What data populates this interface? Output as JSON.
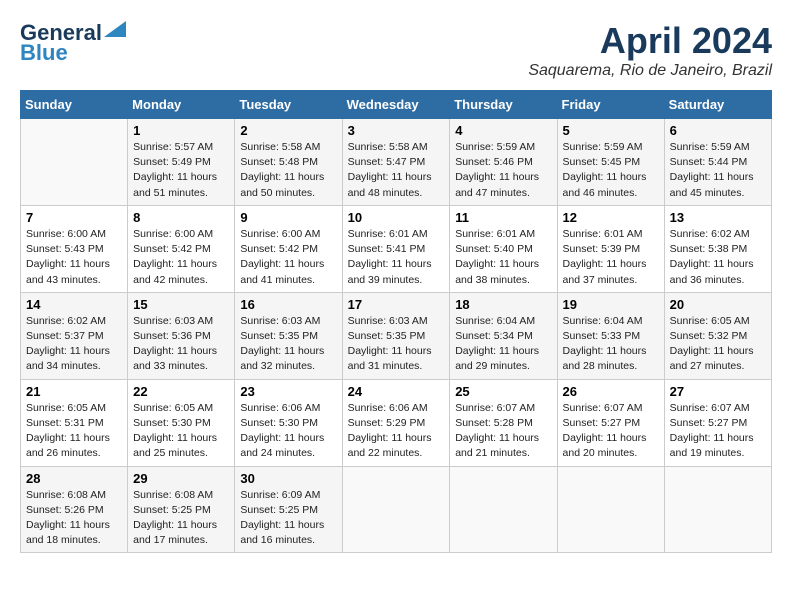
{
  "header": {
    "logo_line1": "General",
    "logo_line2": "Blue",
    "month": "April 2024",
    "location": "Saquarema, Rio de Janeiro, Brazil"
  },
  "weekdays": [
    "Sunday",
    "Monday",
    "Tuesday",
    "Wednesday",
    "Thursday",
    "Friday",
    "Saturday"
  ],
  "weeks": [
    [
      {
        "day": "",
        "info": ""
      },
      {
        "day": "1",
        "info": "Sunrise: 5:57 AM\nSunset: 5:49 PM\nDaylight: 11 hours\nand 51 minutes."
      },
      {
        "day": "2",
        "info": "Sunrise: 5:58 AM\nSunset: 5:48 PM\nDaylight: 11 hours\nand 50 minutes."
      },
      {
        "day": "3",
        "info": "Sunrise: 5:58 AM\nSunset: 5:47 PM\nDaylight: 11 hours\nand 48 minutes."
      },
      {
        "day": "4",
        "info": "Sunrise: 5:59 AM\nSunset: 5:46 PM\nDaylight: 11 hours\nand 47 minutes."
      },
      {
        "day": "5",
        "info": "Sunrise: 5:59 AM\nSunset: 5:45 PM\nDaylight: 11 hours\nand 46 minutes."
      },
      {
        "day": "6",
        "info": "Sunrise: 5:59 AM\nSunset: 5:44 PM\nDaylight: 11 hours\nand 45 minutes."
      }
    ],
    [
      {
        "day": "7",
        "info": "Sunrise: 6:00 AM\nSunset: 5:43 PM\nDaylight: 11 hours\nand 43 minutes."
      },
      {
        "day": "8",
        "info": "Sunrise: 6:00 AM\nSunset: 5:42 PM\nDaylight: 11 hours\nand 42 minutes."
      },
      {
        "day": "9",
        "info": "Sunrise: 6:00 AM\nSunset: 5:42 PM\nDaylight: 11 hours\nand 41 minutes."
      },
      {
        "day": "10",
        "info": "Sunrise: 6:01 AM\nSunset: 5:41 PM\nDaylight: 11 hours\nand 39 minutes."
      },
      {
        "day": "11",
        "info": "Sunrise: 6:01 AM\nSunset: 5:40 PM\nDaylight: 11 hours\nand 38 minutes."
      },
      {
        "day": "12",
        "info": "Sunrise: 6:01 AM\nSunset: 5:39 PM\nDaylight: 11 hours\nand 37 minutes."
      },
      {
        "day": "13",
        "info": "Sunrise: 6:02 AM\nSunset: 5:38 PM\nDaylight: 11 hours\nand 36 minutes."
      }
    ],
    [
      {
        "day": "14",
        "info": "Sunrise: 6:02 AM\nSunset: 5:37 PM\nDaylight: 11 hours\nand 34 minutes."
      },
      {
        "day": "15",
        "info": "Sunrise: 6:03 AM\nSunset: 5:36 PM\nDaylight: 11 hours\nand 33 minutes."
      },
      {
        "day": "16",
        "info": "Sunrise: 6:03 AM\nSunset: 5:35 PM\nDaylight: 11 hours\nand 32 minutes."
      },
      {
        "day": "17",
        "info": "Sunrise: 6:03 AM\nSunset: 5:35 PM\nDaylight: 11 hours\nand 31 minutes."
      },
      {
        "day": "18",
        "info": "Sunrise: 6:04 AM\nSunset: 5:34 PM\nDaylight: 11 hours\nand 29 minutes."
      },
      {
        "day": "19",
        "info": "Sunrise: 6:04 AM\nSunset: 5:33 PM\nDaylight: 11 hours\nand 28 minutes."
      },
      {
        "day": "20",
        "info": "Sunrise: 6:05 AM\nSunset: 5:32 PM\nDaylight: 11 hours\nand 27 minutes."
      }
    ],
    [
      {
        "day": "21",
        "info": "Sunrise: 6:05 AM\nSunset: 5:31 PM\nDaylight: 11 hours\nand 26 minutes."
      },
      {
        "day": "22",
        "info": "Sunrise: 6:05 AM\nSunset: 5:30 PM\nDaylight: 11 hours\nand 25 minutes."
      },
      {
        "day": "23",
        "info": "Sunrise: 6:06 AM\nSunset: 5:30 PM\nDaylight: 11 hours\nand 24 minutes."
      },
      {
        "day": "24",
        "info": "Sunrise: 6:06 AM\nSunset: 5:29 PM\nDaylight: 11 hours\nand 22 minutes."
      },
      {
        "day": "25",
        "info": "Sunrise: 6:07 AM\nSunset: 5:28 PM\nDaylight: 11 hours\nand 21 minutes."
      },
      {
        "day": "26",
        "info": "Sunrise: 6:07 AM\nSunset: 5:27 PM\nDaylight: 11 hours\nand 20 minutes."
      },
      {
        "day": "27",
        "info": "Sunrise: 6:07 AM\nSunset: 5:27 PM\nDaylight: 11 hours\nand 19 minutes."
      }
    ],
    [
      {
        "day": "28",
        "info": "Sunrise: 6:08 AM\nSunset: 5:26 PM\nDaylight: 11 hours\nand 18 minutes."
      },
      {
        "day": "29",
        "info": "Sunrise: 6:08 AM\nSunset: 5:25 PM\nDaylight: 11 hours\nand 17 minutes."
      },
      {
        "day": "30",
        "info": "Sunrise: 6:09 AM\nSunset: 5:25 PM\nDaylight: 11 hours\nand 16 minutes."
      },
      {
        "day": "",
        "info": ""
      },
      {
        "day": "",
        "info": ""
      },
      {
        "day": "",
        "info": ""
      },
      {
        "day": "",
        "info": ""
      }
    ]
  ]
}
